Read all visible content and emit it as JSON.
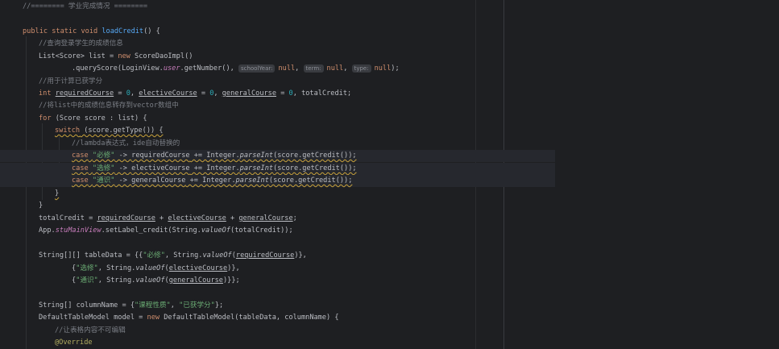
{
  "colors": {
    "background": "#1e1f22",
    "keyword": "#cf8e6d",
    "method_decl": "#56a8f5",
    "comment": "#7a7e85",
    "string": "#6aab73",
    "number": "#2aacb8",
    "field": "#c77dbb",
    "warning_underline": "#c9a33b"
  },
  "code": {
    "c_top": "//======== 学业完成情况 ========",
    "l2": {
      "kw1": "public",
      "kw2": "static",
      "kw3": "void",
      "fn": "loadCredit",
      "rest": "() {"
    },
    "l3": {
      "comment": "//查询登录学生的成绩信息"
    },
    "l4": {
      "a": "List<Score> list = ",
      "kw": "new",
      "b": " ScoreDaoImpl()"
    },
    "l5": {
      "a": ".queryScore(LoginView.",
      "field": "user",
      "b": ".getNumber(), ",
      "hint1": "schoolYear:",
      "v1": "null",
      "sep1": ", ",
      "hint2": "term:",
      "v2": "null",
      "sep2": ", ",
      "hint3": "type:",
      "v3": "null",
      "end": ");"
    },
    "l6": {
      "comment": "//用于计算已获学分"
    },
    "l7": {
      "kw": "int",
      "v1": "requiredCourse",
      "eq1": " = ",
      "n1": "0",
      "s1": ", ",
      "v2": "electiveCourse",
      "eq2": " = ",
      "n2": "0",
      "s2": ", ",
      "v3": "generalCourse",
      "eq3": " = ",
      "n3": "0",
      "end": ", totalCredit;"
    },
    "l8": {
      "comment": "//将list中的成绩信息转存到vector数组中"
    },
    "l9": {
      "kw": "for",
      "rest": " (Score score : list) {"
    },
    "l10": {
      "kw": "switch",
      "rest": " (score.getType()) {"
    },
    "l11": {
      "comment": "//lambda表达式，ide自动替换的"
    },
    "case_kw": "case",
    "arrow": " -> ",
    "integer": " += Integer.",
    "parse": "parseInt",
    "paren": "(score.getCredit());",
    "l12": {
      "str": "\"必修\"",
      "var": "requiredCourse"
    },
    "l13": {
      "str": "\"选修\"",
      "var": "electiveCourse"
    },
    "l14": {
      "str": "\"通识\"",
      "var": "generalCourse"
    },
    "close_brace": "}",
    "l17": {
      "a": "totalCredit = ",
      "v1": "requiredCourse",
      "p1": " + ",
      "v2": "electiveCourse",
      "p2": " + ",
      "v3": "generalCourse",
      "end": ";"
    },
    "l18": {
      "a": "App.",
      "field": "stuMainView",
      "b": ".setLabel_credit(String.",
      "m": "valueOf",
      "c": "(totalCredit));"
    },
    "l20": {
      "a": "String[][] tableData = {{",
      "str": "\"必修\"",
      "b": ", String.",
      "m": "valueOf",
      "c": "(",
      "v": "requiredCourse",
      "d": ")},"
    },
    "l21": {
      "a": "{",
      "str": "\"选修\"",
      "b": ", String.",
      "m": "valueOf",
      "c": "(",
      "v": "electiveCourse",
      "d": ")},"
    },
    "l22": {
      "a": "{",
      "str": "\"通识\"",
      "b": ", String.",
      "m": "valueOf",
      "c": "(",
      "v": "generalCourse",
      "d": ")}};"
    },
    "l24": {
      "a": "String[] columnName = {",
      "s1": "\"课程性质\"",
      "b": ", ",
      "s2": "\"已获学分\"",
      "c": "};"
    },
    "l25": {
      "a": "DefaultTableModel model = ",
      "kw": "new",
      "b": " DefaultTableModel(tableData, columnName) {"
    },
    "l26": {
      "comment": "//让表格内容不可编辑"
    },
    "l27": {
      "ann": "@Override"
    }
  }
}
